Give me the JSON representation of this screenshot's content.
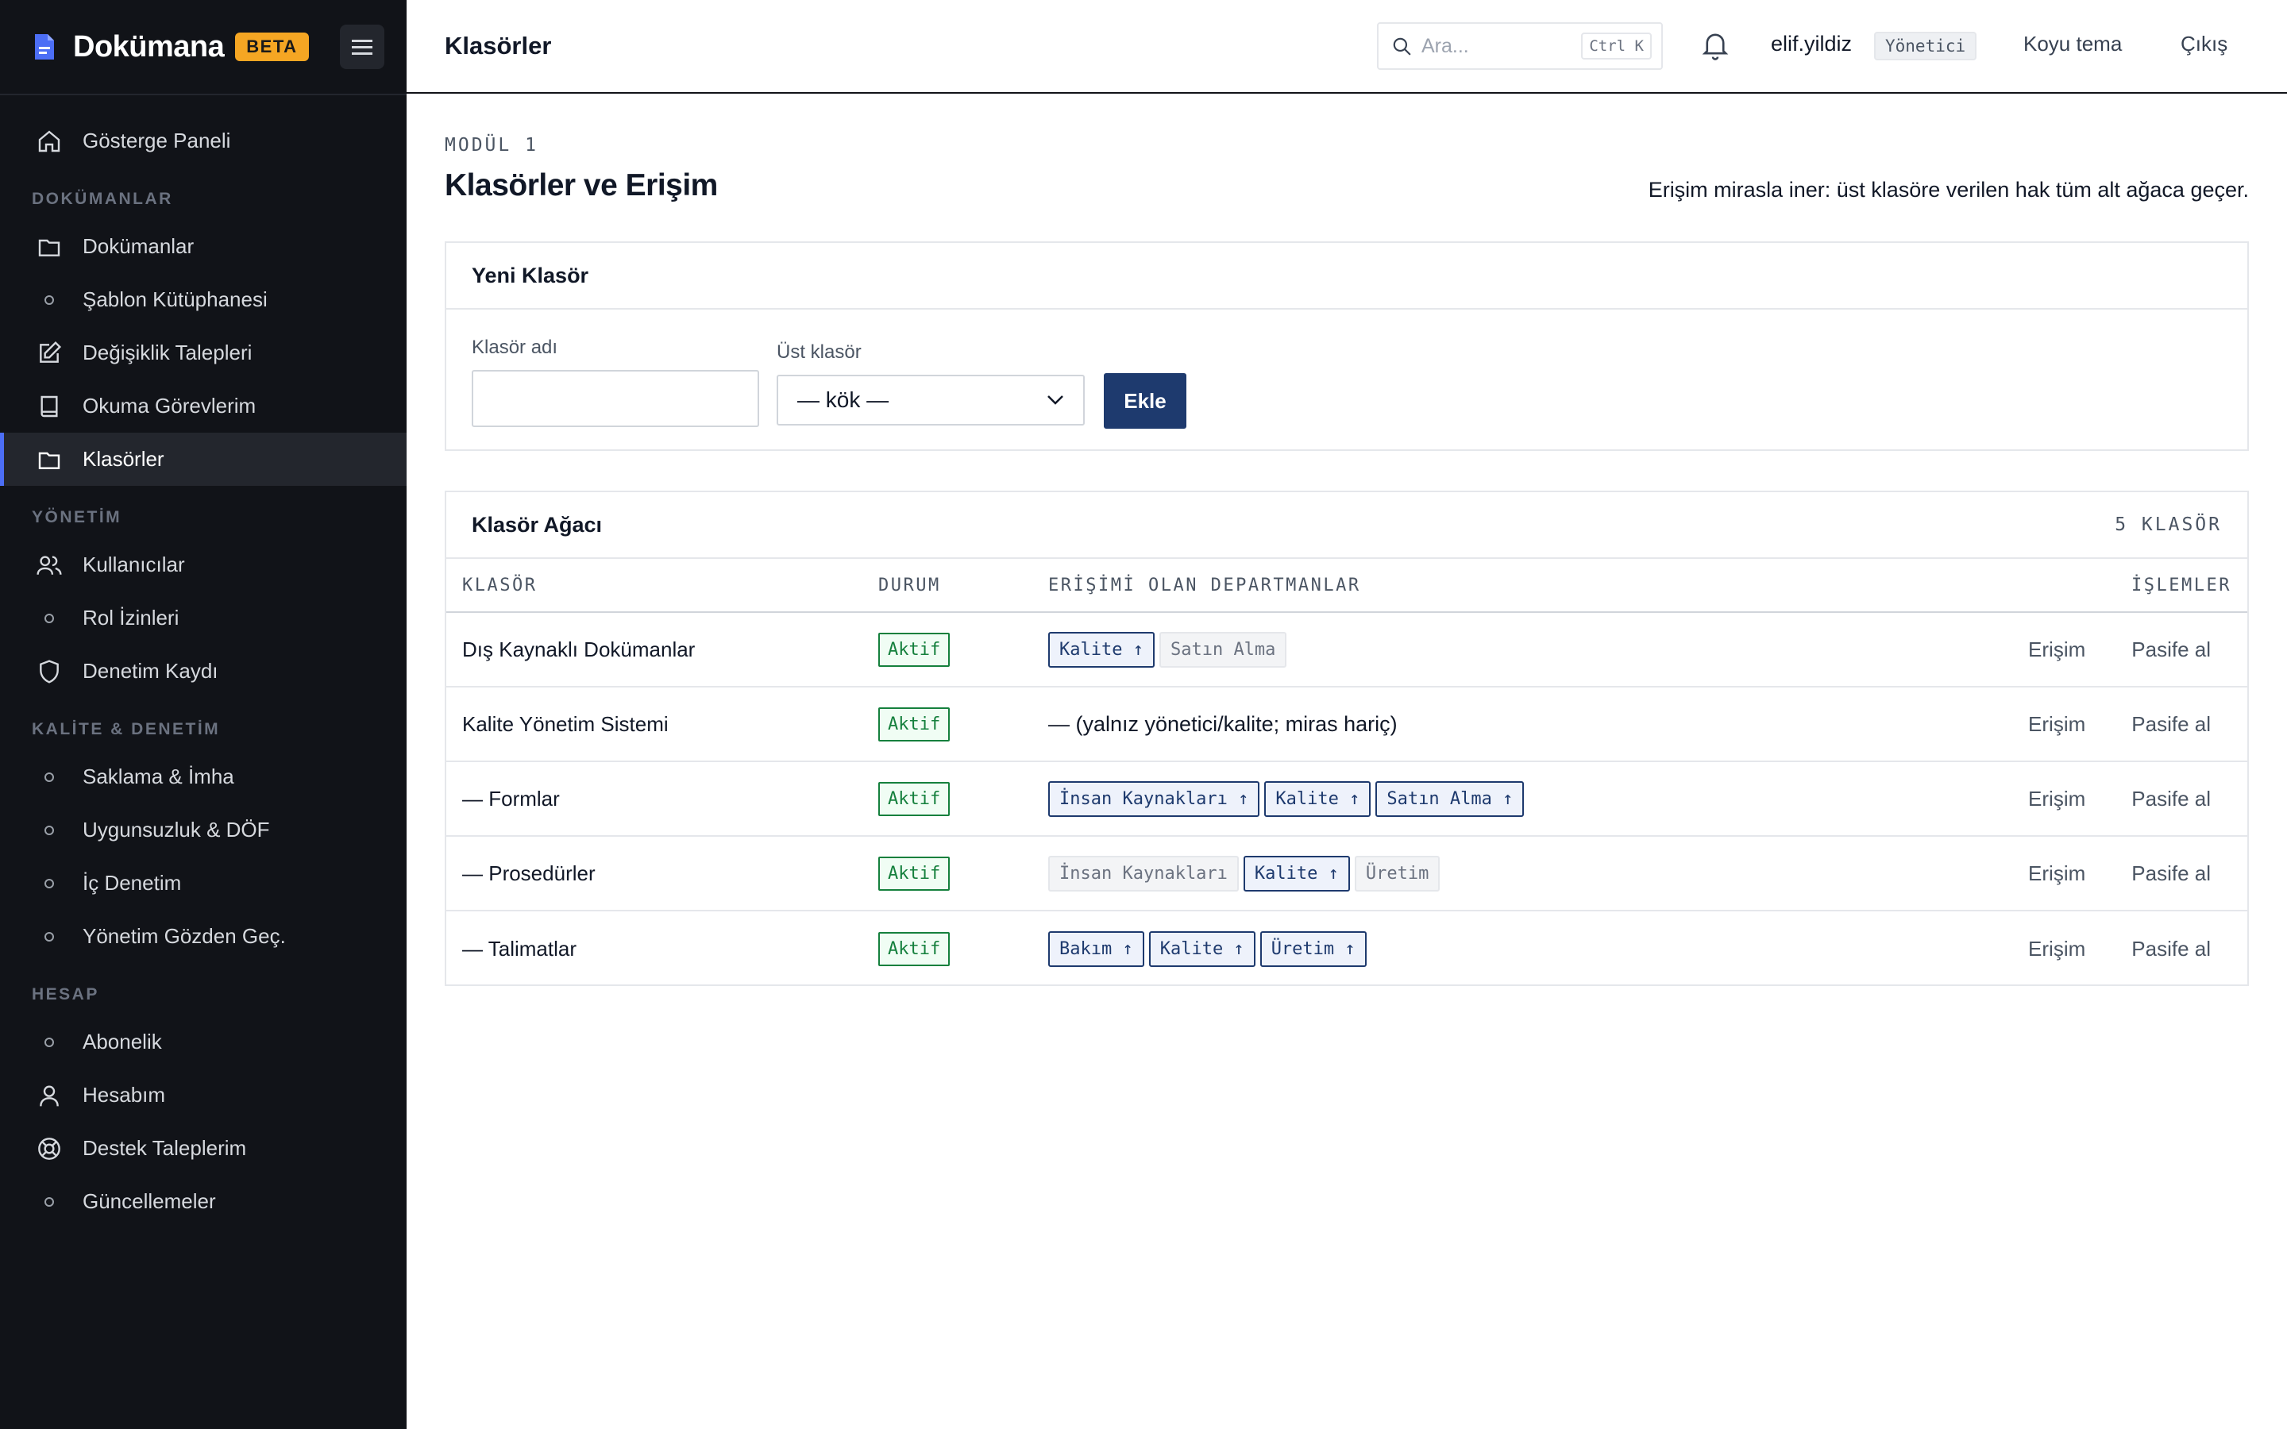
{
  "brand": {
    "name": "Dokümana",
    "badge": "BETA"
  },
  "sidebar": {
    "items": [
      {
        "label": "Gösterge Paneli"
      },
      {
        "section": "DOKÜMANLAR"
      },
      {
        "label": "Dokümanlar"
      },
      {
        "label": "Şablon Kütüphanesi"
      },
      {
        "label": "Değişiklik Talepleri"
      },
      {
        "label": "Okuma Görevlerim"
      },
      {
        "label": "Klasörler",
        "active": true
      },
      {
        "section": "YÖNETİM"
      },
      {
        "label": "Kullanıcılar"
      },
      {
        "label": "Rol İzinleri"
      },
      {
        "label": "Denetim Kaydı"
      },
      {
        "section": "KALİTE & DENETİM"
      },
      {
        "label": "Saklama & İmha"
      },
      {
        "label": "Uygunsuzluk & DÖF"
      },
      {
        "label": "İç Denetim"
      },
      {
        "label": "Yönetim Gözden Geç."
      },
      {
        "section": "HESAP"
      },
      {
        "label": "Abonelik"
      },
      {
        "label": "Hesabım"
      },
      {
        "label": "Destek Taleplerim"
      },
      {
        "label": "Güncellemeler"
      }
    ]
  },
  "topbar": {
    "title": "Klasörler",
    "search_placeholder": "Ara...",
    "search_shortcut": "Ctrl K",
    "user": "elif.yildiz",
    "role": "Yönetici",
    "theme_label": "Koyu tema",
    "logout_label": "Çıkış"
  },
  "page": {
    "eyebrow": "MODÜL 1",
    "title": "Klasörler ve Erişim",
    "note": "Erişim mirasla iner: üst klasöre verilen hak tüm alt ağaca geçer."
  },
  "new_folder": {
    "title": "Yeni Klasör",
    "name_label": "Klasör adı",
    "name_value": "",
    "parent_label": "Üst klasör",
    "parent_value": "— kök —",
    "add_label": "Ekle"
  },
  "tree": {
    "title": "Klasör Ağacı",
    "count": "5 KLASÖR",
    "columns": {
      "name": "KLASÖR",
      "status": "DURUM",
      "departments": "ERİŞİMİ OLAN DEPARTMANLAR",
      "actions": "İŞLEMLER"
    },
    "access_label": "Erişim",
    "deactivate_label": "Pasife al",
    "rows": [
      {
        "name": "Dış Kaynaklı Dokümanlar",
        "status": "Aktif",
        "note": null,
        "depts": [
          {
            "label": "Kalite ↑",
            "inherited": true
          },
          {
            "label": "Satın Alma",
            "inherited": false
          }
        ]
      },
      {
        "name": "Kalite Yönetim Sistemi",
        "status": "Aktif",
        "note": "— (yalnız yönetici/kalite; miras hariç)",
        "depts": []
      },
      {
        "name": "— Formlar",
        "status": "Aktif",
        "note": null,
        "depts": [
          {
            "label": "İnsan Kaynakları ↑",
            "inherited": true
          },
          {
            "label": "Kalite ↑",
            "inherited": true
          },
          {
            "label": "Satın Alma ↑",
            "inherited": true
          }
        ]
      },
      {
        "name": "— Prosedürler",
        "status": "Aktif",
        "note": null,
        "depts": [
          {
            "label": "İnsan Kaynakları",
            "inherited": false
          },
          {
            "label": "Kalite ↑",
            "inherited": true
          },
          {
            "label": "Üretim",
            "inherited": false
          }
        ]
      },
      {
        "name": "— Talimatlar",
        "status": "Aktif",
        "note": null,
        "depts": [
          {
            "label": "Bakım ↑",
            "inherited": true
          },
          {
            "label": "Kalite ↑",
            "inherited": true
          },
          {
            "label": "Üretim ↑",
            "inherited": true
          }
        ]
      }
    ]
  }
}
